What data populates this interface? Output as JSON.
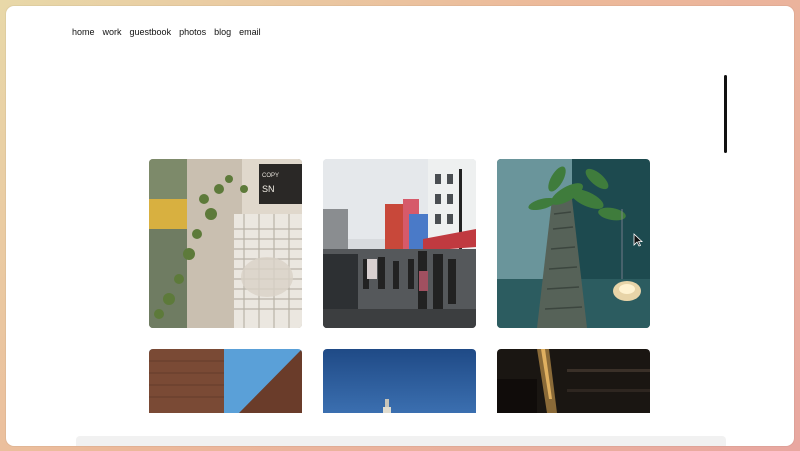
{
  "nav": {
    "items": [
      {
        "label": "home"
      },
      {
        "label": "work"
      },
      {
        "label": "guestbook"
      },
      {
        "label": "photos"
      },
      {
        "label": "blog"
      },
      {
        "label": "email"
      }
    ]
  },
  "gallery": {
    "photos": [
      {
        "subject": "window-fan-with-vines",
        "overlay_text": "COPY",
        "overlay_text2": "SN"
      },
      {
        "subject": "colorful-street-crowd"
      },
      {
        "subject": "palm-trunk-with-lamp"
      },
      {
        "subject": "brick-wall-blue-sky"
      },
      {
        "subject": "blue-sky-tower"
      },
      {
        "subject": "dark-interior-lights"
      }
    ]
  },
  "icons": {
    "cursor": "arrow-cursor-icon"
  }
}
